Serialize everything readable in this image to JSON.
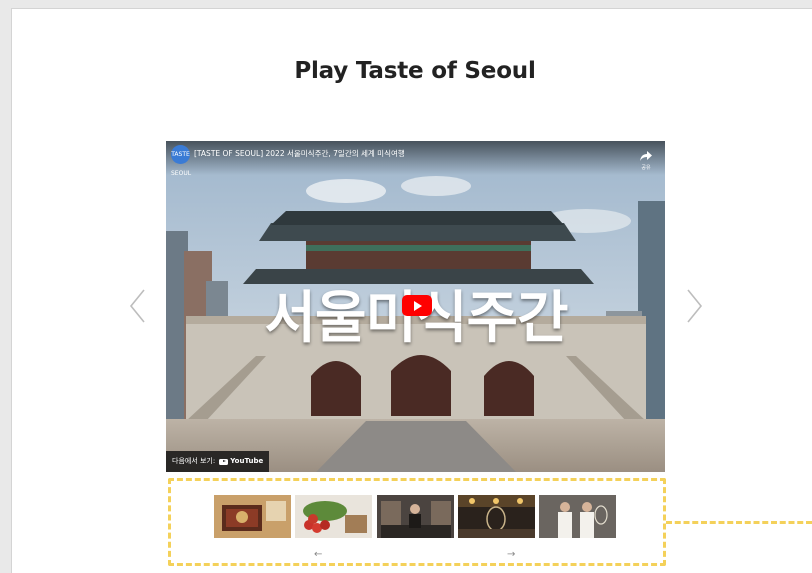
{
  "section": {
    "title": "Play Taste of Seoul"
  },
  "video": {
    "channel_logo_text": "TASTE SEOUL",
    "title": "[TASTE OF SEOUL] 2022 서울미식주간, 7일간의 세계 미식여행",
    "share_label": "공유",
    "caption": "서울미식주간",
    "watch_on_label": "다음에서 보기:",
    "youtube_label": "YouTube"
  },
  "carousel": {
    "prev_icon": "chevron-left-icon",
    "next_icon": "chevron-right-icon"
  },
  "thumbnails": [
    {
      "name": "thumb-dessert-box"
    },
    {
      "name": "thumb-fruits"
    },
    {
      "name": "thumb-chef-kitchen"
    },
    {
      "name": "thumb-bar-interior"
    },
    {
      "name": "thumb-chefs-duo"
    }
  ],
  "thumb_nav": {
    "prev_arrow": "←",
    "next_arrow": "→"
  },
  "colors": {
    "highlight": "#f4d15a",
    "youtube_red": "#ff0000"
  }
}
